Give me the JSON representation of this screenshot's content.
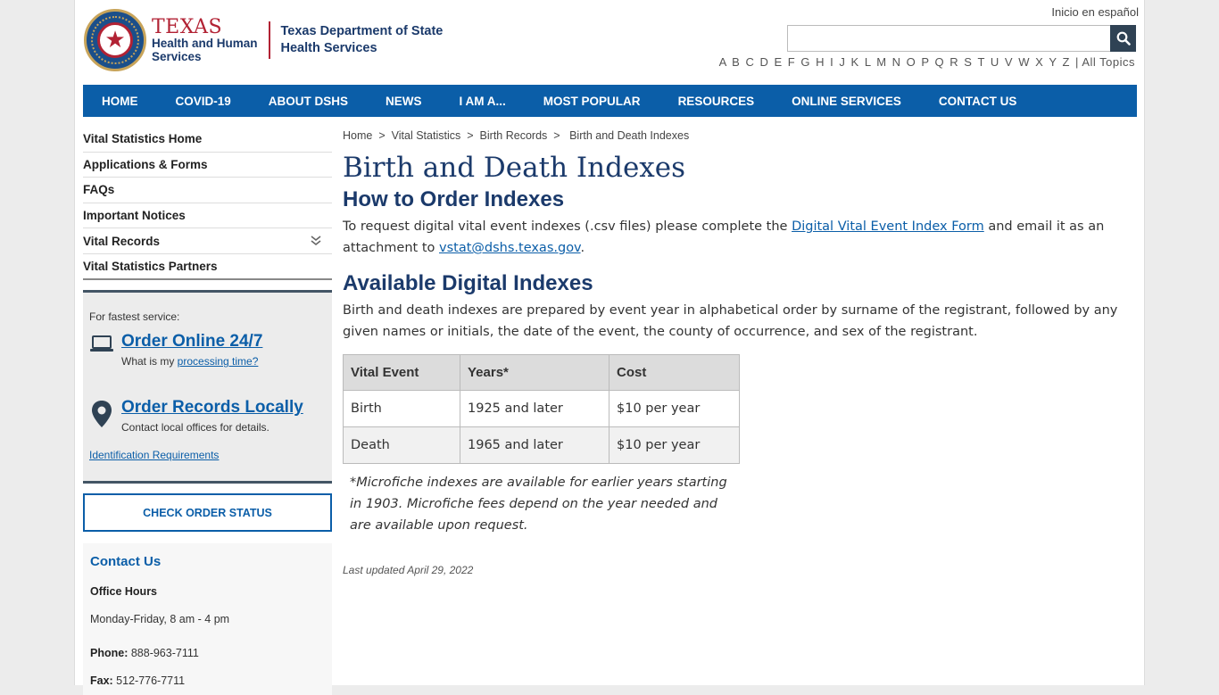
{
  "header": {
    "org_name_1": "TEXAS",
    "org_name_2": "Health and Human",
    "org_name_3": "Services",
    "dept_line_1": "Texas Department of State",
    "dept_line_2": "Health Services",
    "espanol_link": "Inicio en español",
    "search_placeholder": "",
    "alphabet": [
      "A",
      "B",
      "C",
      "D",
      "E",
      "F",
      "G",
      "H",
      "I",
      "J",
      "K",
      "L",
      "M",
      "N",
      "O",
      "P",
      "Q",
      "R",
      "S",
      "T",
      "U",
      "V",
      "W",
      "X",
      "Y",
      "Z"
    ],
    "all_topics": "| All Topics"
  },
  "nav": {
    "items": [
      "HOME",
      "COVID-19",
      "ABOUT DSHS",
      "NEWS",
      "I AM A...",
      "MOST POPULAR",
      "RESOURCES",
      "ONLINE SERVICES",
      "CONTACT US"
    ]
  },
  "sidebar": {
    "items": [
      "Vital Statistics Home",
      "Applications & Forms",
      "FAQs",
      "Important Notices",
      "Vital Records",
      "Vital Statistics Partners"
    ],
    "order": {
      "fastest": "For fastest service:",
      "online_title": "Order Online 24/7",
      "online_sub_prefix": "What is my ",
      "online_sub_link": "processing time?",
      "local_title": "Order Records Locally",
      "local_sub": "Contact local offices for details.",
      "id_req": "Identification Requirements"
    },
    "check_status": "CHECK ORDER STATUS",
    "contact": {
      "title": "Contact Us",
      "hours_label": "Office Hours",
      "hours": "Monday-Friday, 8 am - 4 pm",
      "phone_label": "Phone:",
      "phone": " 888-963-7111",
      "fax_label": "Fax:",
      "fax": " 512-776-7711"
    }
  },
  "breadcrumb": [
    "Home",
    "Vital Statistics",
    "Birth Records",
    "Birth and Death Indexes"
  ],
  "main": {
    "title": "Birth and Death Indexes",
    "h2_order": "How to Order Indexes",
    "p1_a": "To request digital vital event indexes (.csv files) please complete the ",
    "p1_link1": "Digital Vital Event Index Form",
    "p1_b": " and email it as an attachment to ",
    "p1_link2": "vstat@dshs.texas.gov",
    "p1_c": ".",
    "h2_available": "Available Digital Indexes",
    "p2": "Birth and death indexes are prepared by event year in alphabetical order by surname of the registrant, followed by any given names or initials, the date of the event, the county of occurrence, and sex of the registrant.",
    "table": {
      "headers": [
        "Vital Event",
        "Years*",
        "Cost"
      ],
      "rows": [
        [
          "Birth",
          "1925 and later",
          "$10 per year"
        ],
        [
          "Death",
          "1965 and later",
          "$10 per year"
        ]
      ]
    },
    "note": "*Microfiche indexes are available for earlier years starting in 1903. Microfiche fees depend on the year needed and are available upon request.",
    "updated": "Last updated  April 29, 2022"
  }
}
